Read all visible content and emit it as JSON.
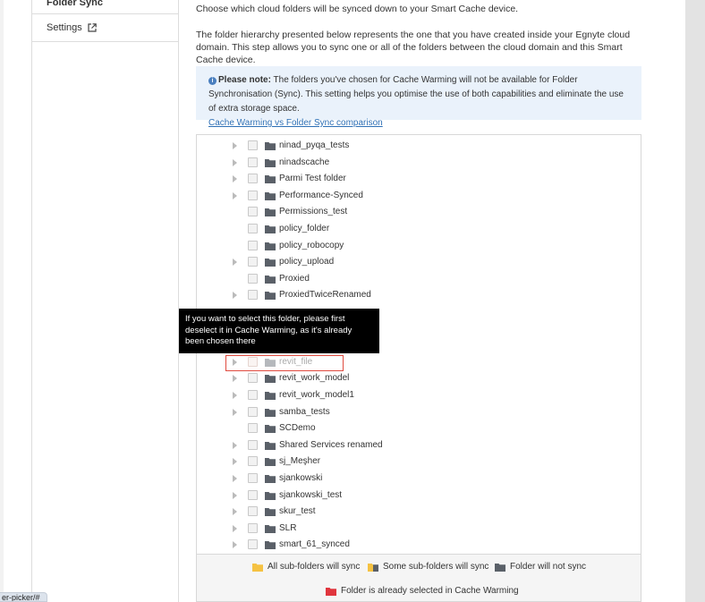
{
  "sidebar": {
    "items": [
      {
        "label": "Folder Sync"
      },
      {
        "label": "Settings"
      }
    ]
  },
  "intro": {
    "line1": "Choose which cloud folders will be synced down to your Smart Cache device.",
    "line2": "The folder hierarchy presented below represents the one that you have created inside your Egnyte cloud domain. This step allows you to sync one or all of the folders between the cloud domain and this Smart Cache device."
  },
  "note": {
    "bold": "Please note:",
    "text": " The folders you've chosen for Cache Warming will not be available for Folder Synchronisation (Sync). This setting helps you optimise the use of both capabilities and eliminate the use of extra storage space.",
    "link": "Cache Warming vs Folder Sync comparison"
  },
  "tree": {
    "rows": [
      {
        "label": "ninad_pyqa_tests",
        "expandable": true
      },
      {
        "label": "ninadscache",
        "expandable": true
      },
      {
        "label": "Parmi Test folder",
        "expandable": true
      },
      {
        "label": "Performance-Synced",
        "expandable": true
      },
      {
        "label": "Permissions_test",
        "expandable": false
      },
      {
        "label": "policy_folder",
        "expandable": false
      },
      {
        "label": "policy_robocopy",
        "expandable": false
      },
      {
        "label": "policy_upload",
        "expandable": true
      },
      {
        "label": "Proxied",
        "expandable": false
      },
      {
        "label": "ProxiedTwiceRenamed",
        "expandable": true
      },
      {
        "label": "",
        "expandable": false
      },
      {
        "label": "",
        "expandable": false
      },
      {
        "label": "",
        "expandable": false
      },
      {
        "label": "revit_file",
        "expandable": true,
        "disabled": true
      },
      {
        "label": "revit_work_model",
        "expandable": true
      },
      {
        "label": "revit_work_model1",
        "expandable": true
      },
      {
        "label": "samba_tests",
        "expandable": true
      },
      {
        "label": "SCDemo",
        "expandable": false
      },
      {
        "label": "Shared Services renamed",
        "expandable": true
      },
      {
        "label": "sj_Meşher",
        "expandable": true
      },
      {
        "label": "sjankowski",
        "expandable": true
      },
      {
        "label": "sjankowski_test",
        "expandable": true
      },
      {
        "label": "skur_test",
        "expandable": true
      },
      {
        "label": "SLR",
        "expandable": true
      },
      {
        "label": "smart_61_synced",
        "expandable": true
      }
    ]
  },
  "tooltip": {
    "text": "If you want to select this folder, please first deselect it in Cache Warming, as it's already been chosen there"
  },
  "legend": {
    "all": "All sub-folders will sync",
    "some": "Some sub-folders will sync",
    "none": "Folder will not sync",
    "cache": "Folder is already selected in Cache Warming"
  },
  "colors": {
    "folder_default": "#5a6068",
    "folder_all": "#f5c242",
    "folder_cache": "#e0353d",
    "accent": "#2d6fb5"
  },
  "statusbar": {
    "url": "er-picker/#"
  }
}
